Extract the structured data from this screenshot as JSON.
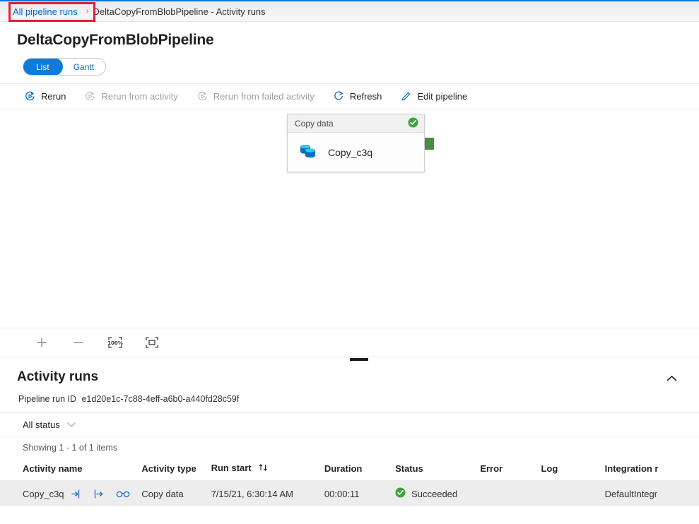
{
  "breadcrumb": {
    "link_label": "All pipeline runs",
    "separator": "›",
    "current": "DeltaCopyFromBlobPipeline - Activity runs",
    "highlight_color": "#e2203c"
  },
  "page_title": "DeltaCopyFromBlobPipeline",
  "view_toggle": {
    "active": "List",
    "options": [
      "List",
      "Gantt"
    ],
    "accent_color": "#0f7ad8"
  },
  "command_bar": {
    "items": [
      {
        "label": "Rerun",
        "icon": "rerun-icon",
        "disabled": false
      },
      {
        "label": "Rerun from activity",
        "icon": "rerun-from-activity-icon",
        "disabled": true
      },
      {
        "label": "Rerun from failed activity",
        "icon": "rerun-from-failed-activity-icon",
        "disabled": true
      },
      {
        "label": "Refresh",
        "icon": "refresh-icon",
        "disabled": false
      },
      {
        "label": "Edit pipeline",
        "icon": "edit-pencil-icon",
        "disabled": false
      }
    ]
  },
  "canvas": {
    "activity_card": {
      "type_label": "Copy data",
      "name": "Copy_c3q",
      "status_icon": "success-check-icon",
      "status_color": "#3ca43c",
      "activity_icon": "copy-data-database-icon",
      "connector_color": "#4a8a4a"
    },
    "zoom_controls": [
      {
        "name": "zoom-in-button",
        "icon": "plus-icon"
      },
      {
        "name": "zoom-out-button",
        "icon": "minus-icon"
      },
      {
        "name": "reset-zoom-button",
        "icon": "zoom-100-percent-icon",
        "label": "100%"
      },
      {
        "name": "fit-to-screen-button",
        "icon": "fit-to-screen-icon"
      }
    ]
  },
  "activity_runs": {
    "title": "Activity runs",
    "collapse_icon": "chevron-up-icon",
    "run_id_label": "Pipeline run ID",
    "run_id_value": "e1d20e1c-7c88-4eff-a6b0-a440fd28c59f",
    "status_filter": "All status",
    "showing": "Showing 1 - 1 of 1 items",
    "columns": [
      "Activity name",
      "Activity type",
      "Run start",
      "Duration",
      "Status",
      "Error",
      "Log",
      "Integration r"
    ],
    "sorted_column": "Run start",
    "rows": [
      {
        "activity_name": "Copy_c3q",
        "row_icons": [
          "input-icon",
          "output-icon",
          "details-glasses-icon"
        ],
        "activity_type": "Copy data",
        "run_start": "7/15/21, 6:30:14 AM",
        "duration": "00:00:11",
        "status": "Succeeded",
        "status_color": "#3ca43c",
        "error": "",
        "log": "",
        "integration_runtime": "DefaultIntegr"
      }
    ]
  }
}
